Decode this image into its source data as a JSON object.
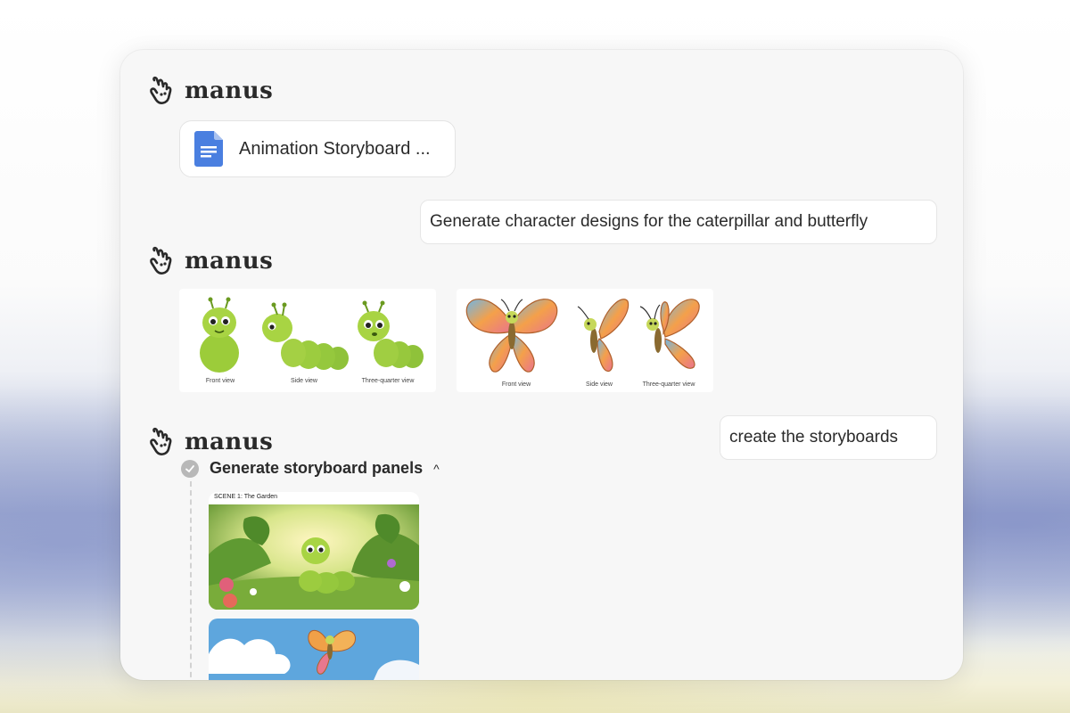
{
  "brand": {
    "name": "manus"
  },
  "file": {
    "name": "Animation Storyboard ...",
    "icon": "document-icon"
  },
  "messages": {
    "user1": "Generate character designs for the caterpillar and butterfly",
    "user2": "create the storyboards"
  },
  "designs": {
    "caterpillar": {
      "captions": [
        "Front view",
        "Side view",
        "Three-quarter view"
      ]
    },
    "butterfly": {
      "captions": [
        "Front view",
        "Side view",
        "Three-quarter view"
      ]
    }
  },
  "step": {
    "title": "Generate storyboard panels",
    "status": "completed",
    "chevron": "^"
  },
  "storyboard": {
    "panels": [
      {
        "scene_label": "SCENE 1: The Garden"
      },
      {
        "scene_label": ""
      }
    ]
  },
  "colors": {
    "accent_blue": "#4a7fe0",
    "card_bg": "#f7f7f7",
    "text": "#2a2a2a"
  }
}
